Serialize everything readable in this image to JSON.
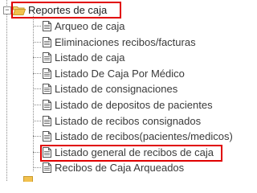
{
  "tree": {
    "toggle_symbol": "−",
    "folder": {
      "label": "Reportes de caja",
      "icon": "folder-open-icon",
      "color": "#f2c14e"
    },
    "items": [
      {
        "label": "Arqueo de caja",
        "icon": "document-icon"
      },
      {
        "label": "Eliminaciones recibos/facturas",
        "icon": "document-icon"
      },
      {
        "label": "Listado de caja",
        "icon": "document-icon"
      },
      {
        "label": "Listado De Caja Por Médico",
        "icon": "document-icon"
      },
      {
        "label": "Listado de consignaciones",
        "icon": "document-icon"
      },
      {
        "label": "Listado de depositos de pacientes",
        "icon": "document-icon"
      },
      {
        "label": "Listado de recibos consignados",
        "icon": "document-icon"
      },
      {
        "label": "Listado de recibos(pacientes/medicos)",
        "icon": "document-icon"
      },
      {
        "label": "Listado general de recibos de caja",
        "icon": "document-icon",
        "highlighted": true
      },
      {
        "label": "Recibos de Caja Arqueados",
        "icon": "document-icon"
      }
    ],
    "highlight_color": "#e00000"
  }
}
